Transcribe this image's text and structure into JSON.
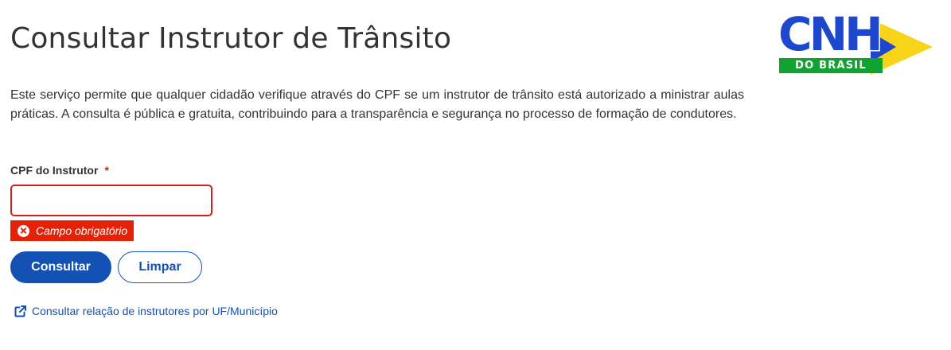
{
  "header": {
    "title": "Consultar Instrutor de Trânsito"
  },
  "logo": {
    "mark": "CNH",
    "label": "DO BRASIL",
    "colors": {
      "blue": "#1d47cc",
      "green": "#11a331",
      "yellow": "#f7d417"
    }
  },
  "description": "Este serviço permite que qualquer cidadão verifique através do CPF se um instrutor de trânsito está autorizado a ministrar aulas práticas. A consulta é pública e gratuita, contribuindo para a transparência e segurança no processo de formação de condutores.",
  "form": {
    "cpf_label": "CPF do Instrutor",
    "required_marker": "*",
    "cpf_value": "",
    "cpf_placeholder": "",
    "error_icon": "close-circle-icon",
    "error_message": "Campo obrigatório"
  },
  "actions": {
    "submit_label": "Consultar",
    "clear_label": "Limpar"
  },
  "link": {
    "icon": "external-link-icon",
    "text": "Consultar relação de instrutores por UF/Município"
  },
  "colors": {
    "text": "#333333",
    "primary": "#1351b4",
    "error": "#e52207",
    "required": "#d0201e"
  }
}
